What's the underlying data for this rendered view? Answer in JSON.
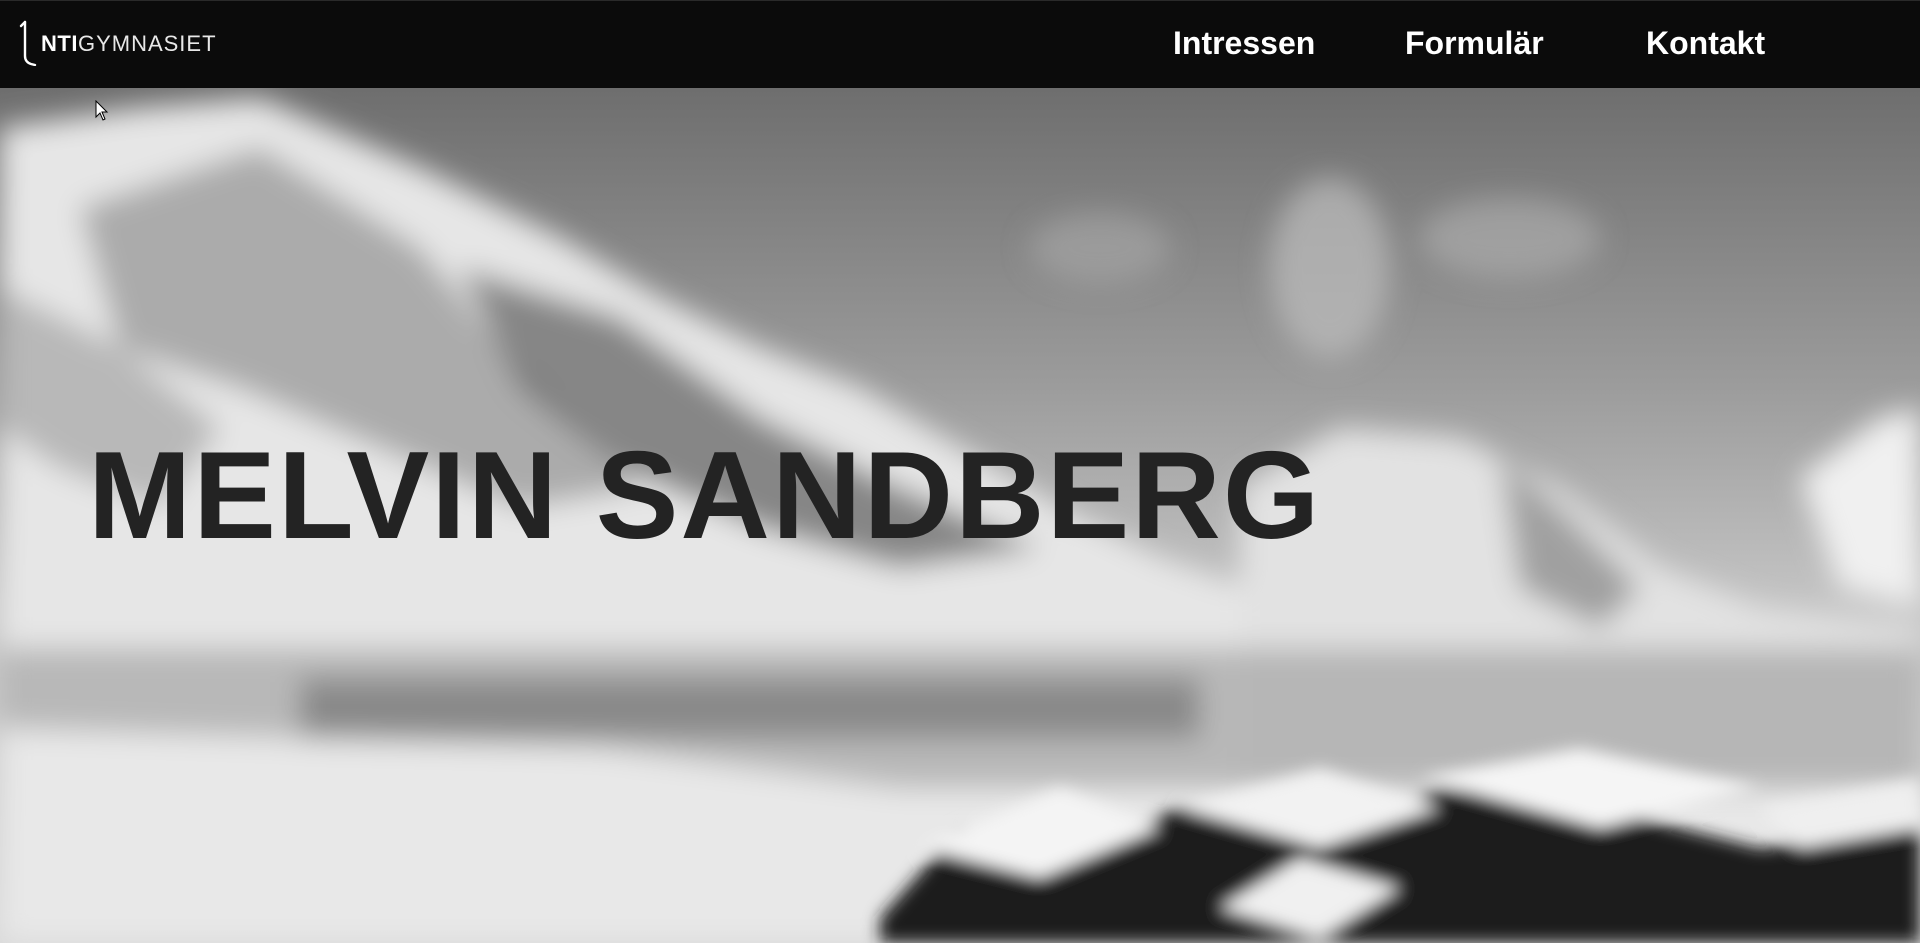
{
  "logo": {
    "mark_icon": "nti-bracket-icon",
    "primary": "NTI",
    "secondary": "GYMNASIET"
  },
  "nav": {
    "items": [
      {
        "label": "Intressen"
      },
      {
        "label": "Formulär"
      },
      {
        "label": "Kontakt"
      }
    ]
  },
  "hero": {
    "title": "MELVIN SANDBERG",
    "background": "blurred-black-and-white-mountain-village-photo"
  },
  "colors": {
    "navbar": "#0b0b0b",
    "nav_text": "#ffffff",
    "title_text": "#232323"
  }
}
